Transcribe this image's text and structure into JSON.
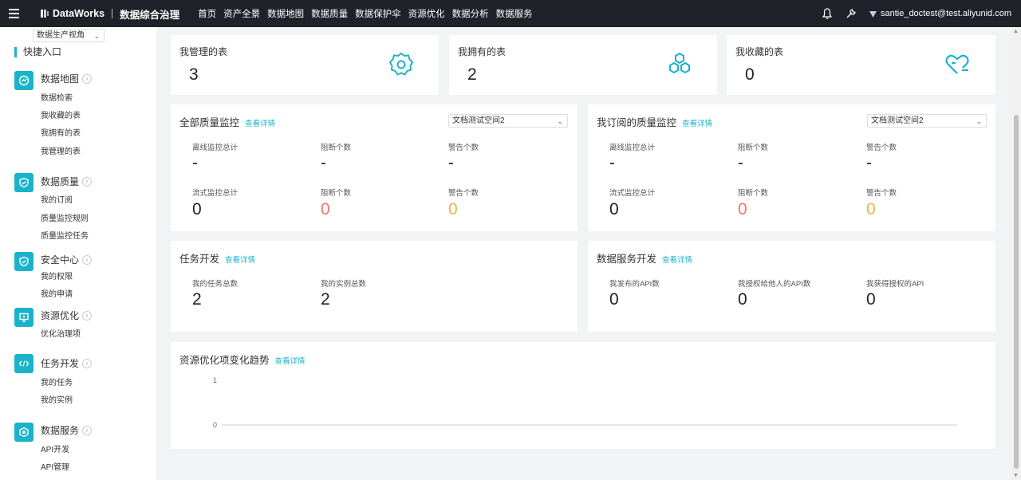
{
  "topbar": {
    "brand": "DataWorks",
    "product": "数据综合治理",
    "nav": [
      "首页",
      "资产全景",
      "数据地图",
      "数据质量",
      "数据保护伞",
      "资源优化",
      "数据分析",
      "数据服务"
    ],
    "user": "santie_doctest@test.aliyunid.com"
  },
  "sidebar": {
    "view_select": "数据生产视角",
    "quick_entry": "快捷入口",
    "groups": [
      {
        "title": "数据地图",
        "items": [
          "数据检索",
          "我收藏的表",
          "我拥有的表",
          "我管理的表"
        ]
      },
      {
        "title": "数据质量",
        "items": [
          "我的订阅",
          "质量监控规则",
          "质量监控任务"
        ]
      },
      {
        "title": "安全中心",
        "items": [
          "我的权限",
          "我的申请"
        ]
      },
      {
        "title": "资源优化",
        "items": [
          "优化治理项"
        ]
      },
      {
        "title": "任务开发",
        "items": [
          "我的任务",
          "我的实例"
        ]
      },
      {
        "title": "数据服务",
        "items": [
          "API开发",
          "API管理"
        ]
      }
    ]
  },
  "stats": [
    {
      "label": "我管理的表",
      "value": "3"
    },
    {
      "label": "我拥有的表",
      "value": "2"
    },
    {
      "label": "我收藏的表",
      "value": "0"
    }
  ],
  "detail_link": "查看详情",
  "quality_all": {
    "title": "全部质量监控",
    "workspace": "文档测试空间2",
    "metrics": [
      {
        "label": "离线监控总计",
        "value": "-"
      },
      {
        "label": "阻断个数",
        "value": "-"
      },
      {
        "label": "警告个数",
        "value": "-"
      },
      {
        "label": "流式监控总计",
        "value": "0"
      },
      {
        "label": "阻断个数",
        "value": "0"
      },
      {
        "label": "警告个数",
        "value": "0"
      }
    ]
  },
  "quality_sub": {
    "title": "我订阅的质量监控",
    "workspace": "文档测试空间2",
    "metrics": [
      {
        "label": "离线监控总计",
        "value": "-"
      },
      {
        "label": "阻断个数",
        "value": "-"
      },
      {
        "label": "警告个数",
        "value": "-"
      },
      {
        "label": "流式监控总计",
        "value": "0"
      },
      {
        "label": "阻断个数",
        "value": "0"
      },
      {
        "label": "警告个数",
        "value": "0"
      }
    ]
  },
  "task_dev": {
    "title": "任务开发",
    "metrics": [
      {
        "label": "我的任务总数",
        "value": "2"
      },
      {
        "label": "我的实例总数",
        "value": "2"
      }
    ]
  },
  "data_service": {
    "title": "数据服务开发",
    "metrics": [
      {
        "label": "我发布的API数",
        "value": "0"
      },
      {
        "label": "我授权给他人的API数",
        "value": "0"
      },
      {
        "label": "我获得授权的API",
        "value": "0"
      }
    ]
  },
  "trend": {
    "title": "资源优化项变化趋势"
  },
  "chart_data": {
    "type": "line",
    "title": "资源优化项变化趋势",
    "y_ticks": [
      "1",
      "0"
    ],
    "ylim": [
      0,
      1
    ],
    "series": [],
    "grid": true
  },
  "colors": {
    "accent": "#1ab3ca",
    "topbar": "#1f2228",
    "block": "#f0766e",
    "warn": "#f5b041"
  }
}
